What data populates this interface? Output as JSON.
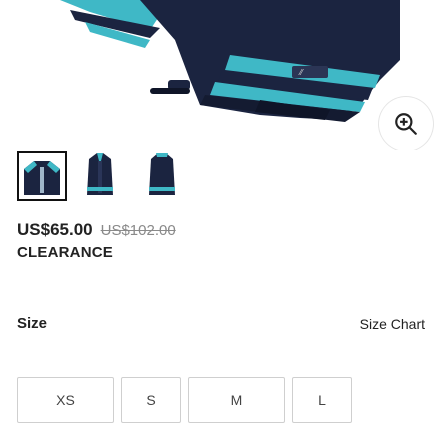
{
  "product": {
    "price_current": "US$65.00",
    "price_original": "US$102.00",
    "badge": "CLEARANCE"
  },
  "gallery": {
    "thumbnails": [
      "thumbnail-1",
      "thumbnail-2",
      "thumbnail-3"
    ],
    "selected_index": 0
  },
  "size": {
    "label": "Size",
    "chart_link": "Size Chart",
    "options": [
      "XS",
      "S",
      "M",
      "L"
    ]
  },
  "colors": {
    "navy": "#1b2440",
    "teal": "#3fb8c6",
    "accent_text": "#222222",
    "strike": "#8a8a8a",
    "border": "#cfcfcf"
  },
  "icons": {
    "zoom": "zoom-in-icon"
  }
}
